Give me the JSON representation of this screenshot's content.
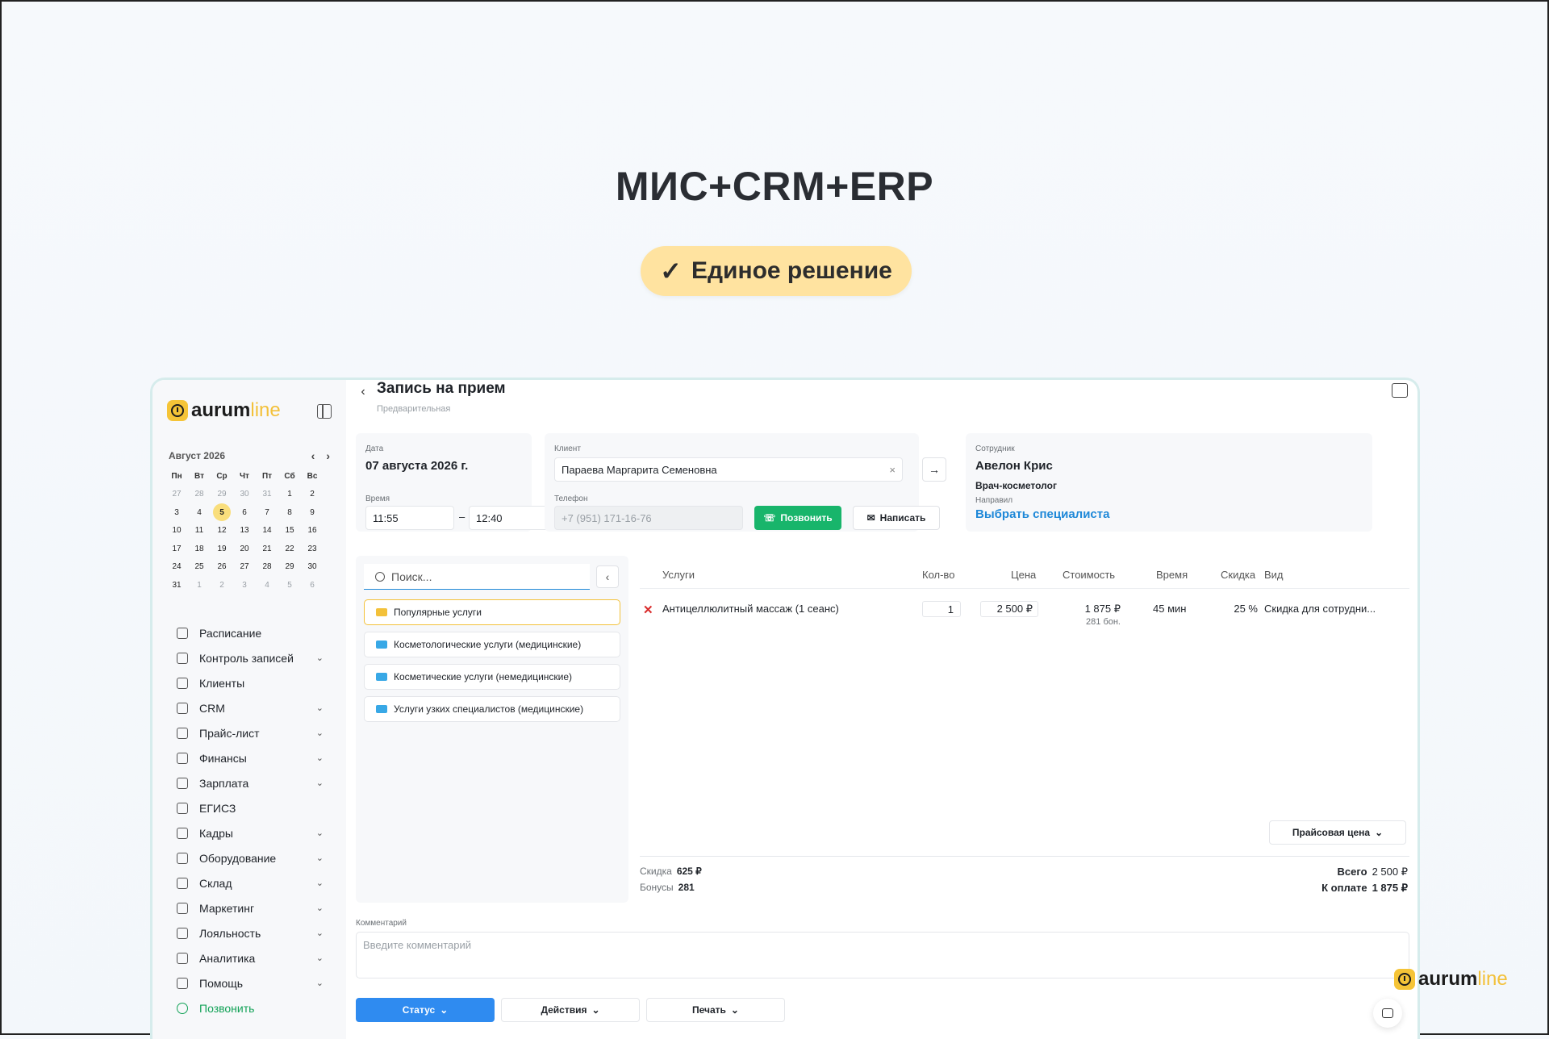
{
  "hero": {
    "title": "МИС+CRM+ERP",
    "badge_check": "✓",
    "badge_text": "Единое решение"
  },
  "brand": {
    "name_a": "aurum",
    "name_b": "line",
    "color_primary": "#f3c13a"
  },
  "calendar": {
    "month": "Август 2026",
    "weekdays": [
      "Пн",
      "Вт",
      "Ср",
      "Чт",
      "Пт",
      "Сб",
      "Вс"
    ],
    "weeks": [
      [
        "27",
        "28",
        "29",
        "30",
        "31",
        "1",
        "2"
      ],
      [
        "3",
        "4",
        "5",
        "6",
        "7",
        "8",
        "9"
      ],
      [
        "10",
        "11",
        "12",
        "13",
        "14",
        "15",
        "16"
      ],
      [
        "17",
        "18",
        "19",
        "20",
        "21",
        "22",
        "23"
      ],
      [
        "24",
        "25",
        "26",
        "27",
        "28",
        "29",
        "30"
      ],
      [
        "31",
        "1",
        "2",
        "3",
        "4",
        "5",
        "6"
      ]
    ],
    "today": "5"
  },
  "nav": [
    {
      "label": "Расписание",
      "chevron": false
    },
    {
      "label": "Контроль записей",
      "chevron": true
    },
    {
      "label": "Клиенты",
      "chevron": false
    },
    {
      "label": "CRM",
      "chevron": true
    },
    {
      "label": "Прайс-лист",
      "chevron": true
    },
    {
      "label": "Финансы",
      "chevron": true
    },
    {
      "label": "Зарплата",
      "chevron": true
    },
    {
      "label": "ЕГИСЗ",
      "chevron": false
    },
    {
      "label": "Кадры",
      "chevron": true
    },
    {
      "label": "Оборудование",
      "chevron": true
    },
    {
      "label": "Склад",
      "chevron": true
    },
    {
      "label": "Маркетинг",
      "chevron": true
    },
    {
      "label": "Лояльность",
      "chevron": true
    },
    {
      "label": "Аналитика",
      "chevron": true
    },
    {
      "label": "Помощь",
      "chevron": true
    },
    {
      "label": "Позвонить",
      "chevron": false
    }
  ],
  "page": {
    "title": "Запись на прием",
    "subtitle": "Предварительная"
  },
  "date_card": {
    "date_label": "Дата",
    "date_value": "07 августа 2026 г.",
    "time_label": "Время",
    "time_from": "11:55",
    "time_sep": "–",
    "time_to": "12:40"
  },
  "client_card": {
    "client_label": "Клиент",
    "client_value": "Параева Маргарита Семеновна",
    "clear": "×",
    "go": "→",
    "phone_label": "Телефон",
    "phone_value": "+7 (951) 171-16-76",
    "call_button": "Позвонить",
    "write_button": "Написать"
  },
  "staff_card": {
    "label": "Сотрудник",
    "name": "Авелон Крис",
    "role": "Врач-косметолог",
    "referred_label": "Направил",
    "choose_link": "Выбрать специалиста"
  },
  "services_panel": {
    "search_placeholder": "Поиск...",
    "items": [
      "Популярные услуги",
      "Косметологические услуги (медицинские)",
      "Косметические услуги (немедицинские)",
      "Услуги узких специалистов (медицинские)"
    ]
  },
  "table": {
    "headers": [
      "Услуги",
      "Кол-во",
      "Цена",
      "Стоимость",
      "Время",
      "Скидка",
      "Вид"
    ],
    "row": {
      "service": "Антицеллюлитный массаж (1 сеанс)",
      "qty": "1",
      "price": "2 500 ₽",
      "cost": "1 875 ₽",
      "cost_bonus": "281 бон.",
      "time": "45 мин",
      "discount": "25 %",
      "kind": "Скидка для сотрудни..."
    },
    "price_mode": "Прайсовая цена"
  },
  "totals": {
    "discount_label": "Скидка",
    "discount_value": "625 ₽",
    "bonus_label": "Бонусы",
    "bonus_value": "281",
    "total_label": "Всего",
    "total_value": "2 500 ₽",
    "pay_label": "К оплате",
    "pay_value": "1 875 ₽"
  },
  "comment": {
    "label": "Комментарий",
    "placeholder": "Введите комментарий"
  },
  "actions": {
    "status": "Статус",
    "actions": "Действия",
    "print": "Печать"
  }
}
